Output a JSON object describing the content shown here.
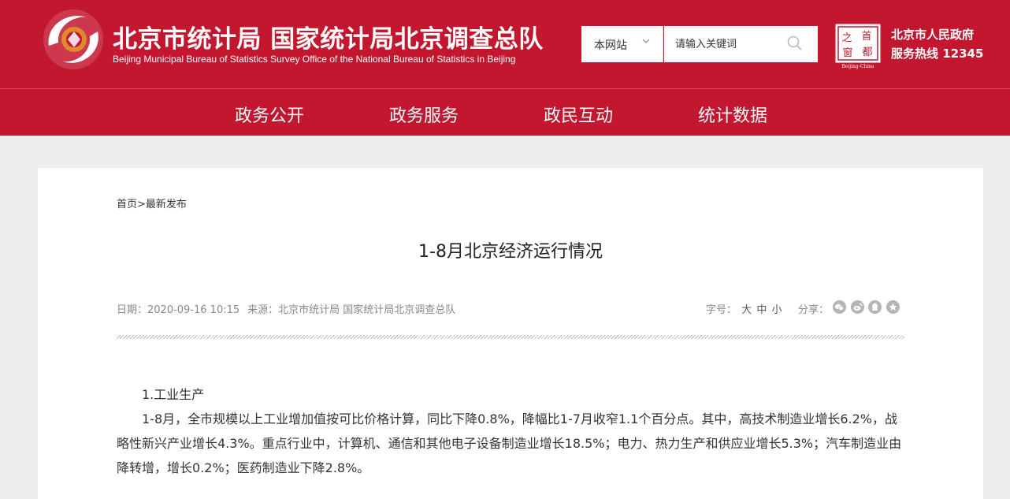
{
  "header": {
    "title_cn": "北京市统计局 国家统计局北京调查总队",
    "title_en": "Beijing Municipal Bureau of Statistics  Survey Office of the National Bureau of Statistics in Beijing",
    "search": {
      "scope": "本网站",
      "placeholder": "请输入关键词"
    },
    "capital_logo": {
      "chars": [
        "之",
        "首",
        "窗",
        "都"
      ],
      "caption": "Beijing-China"
    },
    "gov": {
      "line1": "北京市人民政府",
      "line2": "服务热线 12345"
    }
  },
  "nav": {
    "items": [
      "政务公开",
      "政务服务",
      "政民互动",
      "统计数据"
    ]
  },
  "article": {
    "breadcrumb": {
      "home": "首页",
      "sep": ">",
      "current": "最新发布"
    },
    "title": "1-8月北京经济运行情况",
    "date": "日期：2020-09-16 10:15",
    "source": "来源：北京市统计局 国家统计局北京调查总队",
    "fontsize_label": "字号：",
    "fontsize_options": [
      "大",
      "中",
      "小"
    ],
    "share_label": "分享：",
    "share_icons": [
      "wechat-icon",
      "weibo-icon",
      "qq-icon",
      "star-icon"
    ],
    "section_heading": "1.工业生产",
    "paragraph": "1-8月，全市规模以上工业增加值按可比价格计算，同比下降0.8%，降幅比1-7月收窄1.1个百分点。其中，高技术制造业增长6.2%，战略性新兴产业增长4.3%。重点行业中，计算机、通信和其他电子设备制造业增长18.5%；电力、热力生产和供应业增长5.3%；汽车制造业由降转增，增长0.2%；医药制造业下降2.8%。"
  },
  "colors": {
    "brand_red": "#c3172f",
    "panel_bg": "#ffffff",
    "page_bg": "#eeeeee"
  }
}
